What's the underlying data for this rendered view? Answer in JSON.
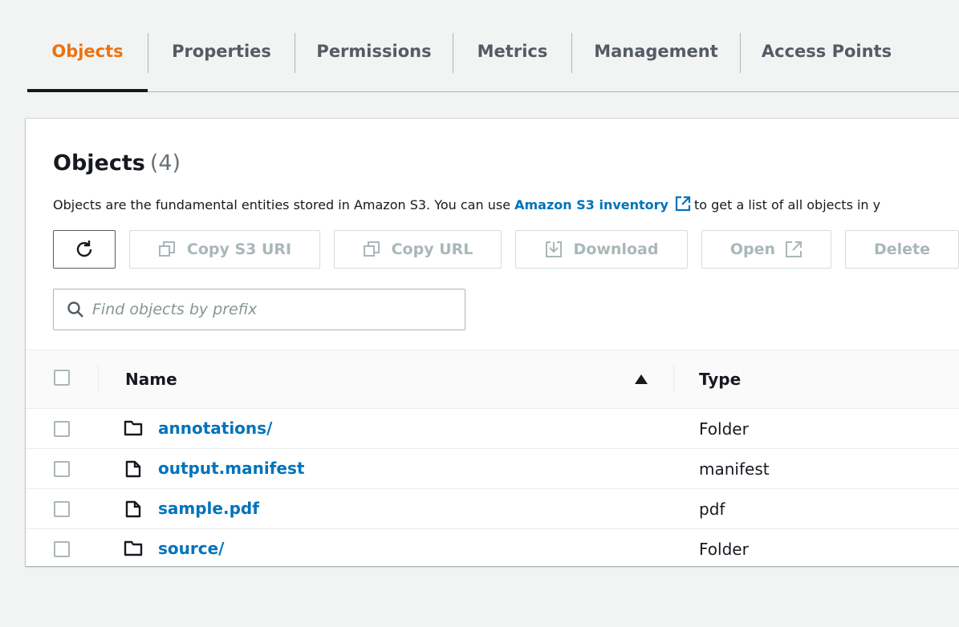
{
  "tabs": [
    {
      "label": "Objects",
      "active": true
    },
    {
      "label": "Properties",
      "active": false
    },
    {
      "label": "Permissions",
      "active": false
    },
    {
      "label": "Metrics",
      "active": false
    },
    {
      "label": "Management",
      "active": false
    },
    {
      "label": "Access Points",
      "active": false
    }
  ],
  "panel": {
    "title": "Objects",
    "count": "(4)",
    "description_prefix": "Objects are the fundamental entities stored in Amazon S3. You can use",
    "description_link": "Amazon S3 inventory",
    "description_suffix": "to get a list of all objects in y"
  },
  "toolbar": {
    "refresh_icon": "refresh-icon",
    "copy_s3_uri_label": "Copy S3 URI",
    "copy_url_label": "Copy URL",
    "download_label": "Download",
    "open_label": "Open",
    "delete_label": "Delete"
  },
  "search": {
    "placeholder": "Find objects by prefix",
    "value": ""
  },
  "table": {
    "columns": {
      "name": "Name",
      "type": "Type"
    },
    "sort": "ascending",
    "rows": [
      {
        "name": "annotations/",
        "type": "Folder",
        "icon": "folder-icon"
      },
      {
        "name": "output.manifest",
        "type": "manifest",
        "icon": "file-icon"
      },
      {
        "name": "sample.pdf",
        "type": "pdf",
        "icon": "file-icon"
      },
      {
        "name": "source/",
        "type": "Folder",
        "icon": "folder-icon"
      }
    ]
  },
  "colors": {
    "accent": "#ec7211",
    "link": "#0073bb",
    "text": "#16191f",
    "disabled": "#aab7b8",
    "background": "#f2f3f3"
  }
}
